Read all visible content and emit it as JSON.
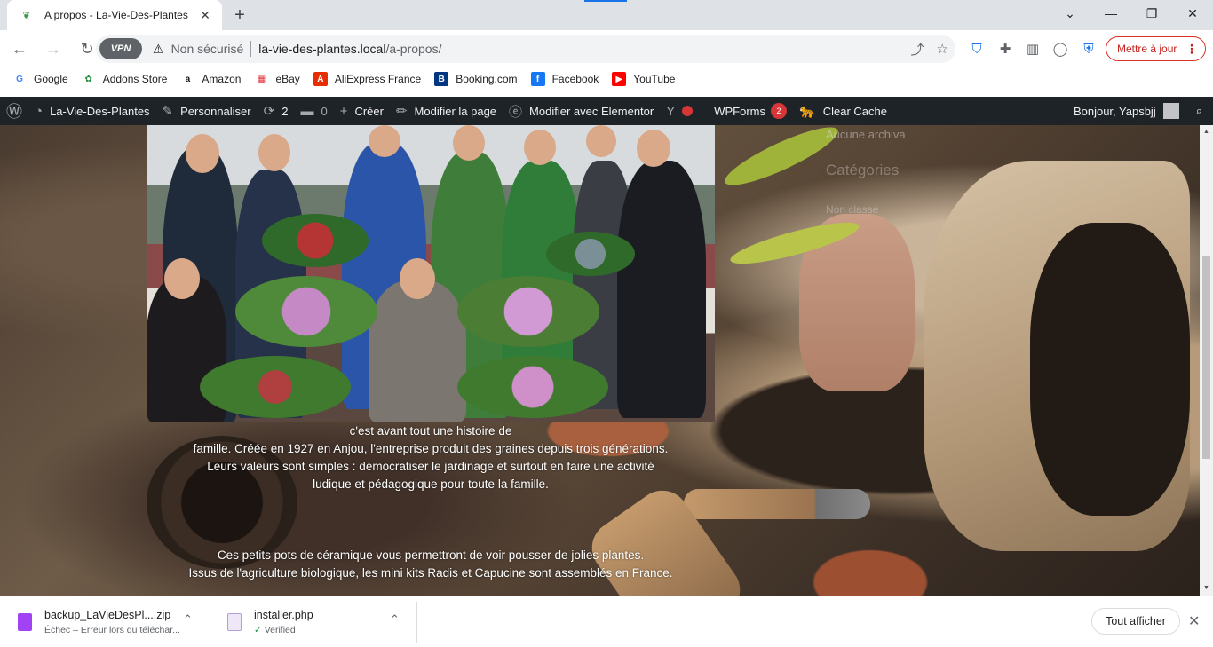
{
  "browser": {
    "tab": {
      "title": "A propos - La-Vie-Des-Plantes",
      "favicon_icon": "plant-favicon-icon",
      "close_icon": "close-icon"
    },
    "new_tab_icon": "plus-icon",
    "window_controls": [
      "chevron-down-icon",
      "minimize-icon",
      "restore-icon",
      "close-icon"
    ],
    "nav": {
      "back_icon": "back-arrow-icon",
      "forward_icon": "forward-arrow-icon",
      "reload_icon": "reload-icon"
    },
    "omnibox": {
      "vpn_label": "VPN",
      "security_label": "Non sécurisé",
      "url_host": "la-vie-des-plantes.local",
      "url_path": "/a-propos/"
    },
    "update_button": {
      "label": "Mettre à jour"
    }
  },
  "bookmarks": [
    {
      "label": "Google",
      "icon": "google-icon",
      "color": "#4285f4"
    },
    {
      "label": "Addons Store",
      "icon": "addons-store-icon",
      "color": "#1e8e3e"
    },
    {
      "label": "Amazon",
      "icon": "amazon-icon",
      "color": "#111111"
    },
    {
      "label": "eBay",
      "icon": "ebay-icon",
      "color": "#e53238"
    },
    {
      "label": "AliExpress France",
      "icon": "aliexpress-icon",
      "color": "#e62e04"
    },
    {
      "label": "Booking.com",
      "icon": "booking-icon",
      "color": "#003580"
    },
    {
      "label": "Facebook",
      "icon": "facebook-icon",
      "color": "#1877f2"
    },
    {
      "label": "YouTube",
      "icon": "youtube-icon",
      "color": "#ff0000"
    }
  ],
  "wp_admin_bar": {
    "site_name": "La-Vie-Des-Plantes",
    "customize": "Personnaliser",
    "updates_count": "2",
    "comments_count": "0",
    "create": "Créer",
    "edit_page": "Modifier la page",
    "edit_elementor": "Modifier avec Elementor",
    "wpforms": "WPForms",
    "wpforms_badge": "2",
    "clear_cache": "Clear Cache",
    "greeting": "Bonjour, Yapsbjj"
  },
  "sidebar": {
    "archives_empty": "Aucune archiva",
    "categories_title": "Catégories",
    "category_item": "Non classé"
  },
  "content": {
    "paragraph1": [
      "c'est avant tout une histoire de",
      "famille. Créée en 1927 en Anjou, l'entreprise produit des graines depuis trois générations.",
      "Leurs valeurs sont simples : démocratiser le jardinage et surtout en faire une activité",
      "ludique et pédagogique pour toute la famille."
    ],
    "paragraph2": [
      "Ces petits pots de céramique vous permettront de voir pousser de jolies plantes.",
      "Issus de l'agriculture biologique, les mini kits Radis et Capucine sont assemblés en France."
    ]
  },
  "downloads": [
    {
      "name": "backup_LaVieDesPl....zip",
      "status": "Échec – Erreur lors du téléchar...",
      "icon": "zip-file-icon",
      "color": "#a142f4"
    },
    {
      "name": "installer.php",
      "status": "Verified",
      "icon": "php-file-icon",
      "color": "#7c4dff"
    }
  ],
  "download_bar": {
    "show_all": "Tout afficher"
  }
}
